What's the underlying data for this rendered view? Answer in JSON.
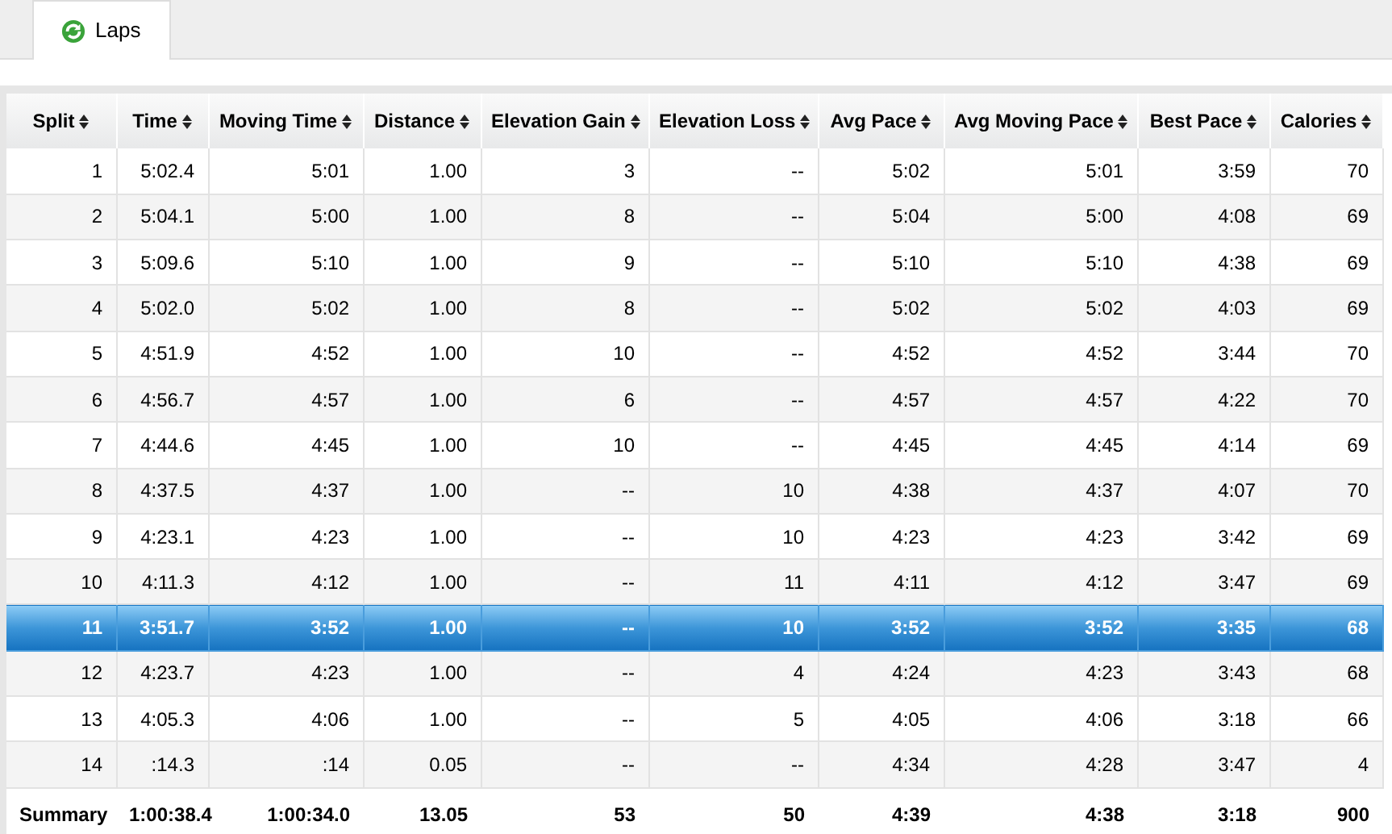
{
  "tabs": [
    {
      "label": "Laps",
      "selected": true
    }
  ],
  "table": {
    "columns": [
      "Split",
      "Time",
      "Moving Time",
      "Distance",
      "Elevation Gain",
      "Elevation Loss",
      "Avg Pace",
      "Avg Moving Pace",
      "Best Pace",
      "Calories"
    ],
    "rows": [
      {
        "cells": [
          "1",
          "5:02.4",
          "5:01",
          "1.00",
          "3",
          "--",
          "5:02",
          "5:01",
          "3:59",
          "70"
        ],
        "selected": false
      },
      {
        "cells": [
          "2",
          "5:04.1",
          "5:00",
          "1.00",
          "8",
          "--",
          "5:04",
          "5:00",
          "4:08",
          "69"
        ],
        "selected": false
      },
      {
        "cells": [
          "3",
          "5:09.6",
          "5:10",
          "1.00",
          "9",
          "--",
          "5:10",
          "5:10",
          "4:38",
          "69"
        ],
        "selected": false
      },
      {
        "cells": [
          "4",
          "5:02.0",
          "5:02",
          "1.00",
          "8",
          "--",
          "5:02",
          "5:02",
          "4:03",
          "69"
        ],
        "selected": false
      },
      {
        "cells": [
          "5",
          "4:51.9",
          "4:52",
          "1.00",
          "10",
          "--",
          "4:52",
          "4:52",
          "3:44",
          "70"
        ],
        "selected": false
      },
      {
        "cells": [
          "6",
          "4:56.7",
          "4:57",
          "1.00",
          "6",
          "--",
          "4:57",
          "4:57",
          "4:22",
          "70"
        ],
        "selected": false
      },
      {
        "cells": [
          "7",
          "4:44.6",
          "4:45",
          "1.00",
          "10",
          "--",
          "4:45",
          "4:45",
          "4:14",
          "69"
        ],
        "selected": false
      },
      {
        "cells": [
          "8",
          "4:37.5",
          "4:37",
          "1.00",
          "--",
          "10",
          "4:38",
          "4:37",
          "4:07",
          "70"
        ],
        "selected": false
      },
      {
        "cells": [
          "9",
          "4:23.1",
          "4:23",
          "1.00",
          "--",
          "10",
          "4:23",
          "4:23",
          "3:42",
          "69"
        ],
        "selected": false
      },
      {
        "cells": [
          "10",
          "4:11.3",
          "4:12",
          "1.00",
          "--",
          "11",
          "4:11",
          "4:12",
          "3:47",
          "69"
        ],
        "selected": false
      },
      {
        "cells": [
          "11",
          "3:51.7",
          "3:52",
          "1.00",
          "--",
          "10",
          "3:52",
          "3:52",
          "3:35",
          "68"
        ],
        "selected": true
      },
      {
        "cells": [
          "12",
          "4:23.7",
          "4:23",
          "1.00",
          "--",
          "4",
          "4:24",
          "4:23",
          "3:43",
          "68"
        ],
        "selected": false
      },
      {
        "cells": [
          "13",
          "4:05.3",
          "4:06",
          "1.00",
          "--",
          "5",
          "4:05",
          "4:06",
          "3:18",
          "66"
        ],
        "selected": false
      },
      {
        "cells": [
          "14",
          ":14.3",
          ":14",
          "0.05",
          "--",
          "--",
          "4:34",
          "4:28",
          "3:47",
          "4"
        ],
        "selected": false
      }
    ],
    "summary": [
      "Summary",
      "1:00:38.4",
      "1:00:34.0",
      "13.05",
      "53",
      "50",
      "4:39",
      "4:38",
      "3:18",
      "900"
    ]
  }
}
